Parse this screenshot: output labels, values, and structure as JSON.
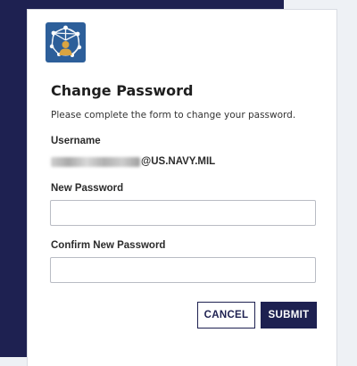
{
  "colors": {
    "brand_navy": "#1e2151",
    "page_background": "#eef1f5",
    "card_background": "#ffffff",
    "logo_background": "#2d5f9a",
    "logo_person_accent": "#d9a441"
  },
  "logo": {
    "icon": "network-person-icon"
  },
  "form": {
    "title": "Change Password",
    "subtitle": "Please complete the form to change your password.",
    "username_label": "Username",
    "username_domain": "@US.NAVY.MIL",
    "new_password_label": "New Password",
    "new_password_value": "",
    "confirm_password_label": "Confirm New Password",
    "confirm_password_value": ""
  },
  "actions": {
    "cancel_label": "CANCEL",
    "submit_label": "SUBMIT"
  }
}
